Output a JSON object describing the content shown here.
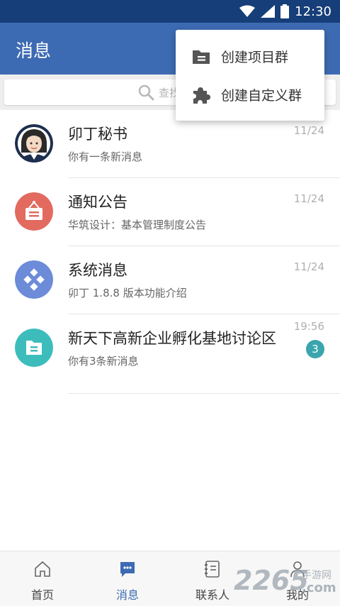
{
  "status_bar": {
    "time": "12:30"
  },
  "header": {
    "title": "消息"
  },
  "search": {
    "placeholder": "查找"
  },
  "popup_menu": {
    "items": [
      {
        "label": "创建项目群",
        "icon": "folder-icon"
      },
      {
        "label": "创建自定义群",
        "icon": "puzzle-icon"
      }
    ]
  },
  "messages": [
    {
      "title": "卯丁秘书",
      "subtitle": "你有一条新消息",
      "time": "11/24",
      "avatar": "secretary-avatar"
    },
    {
      "title": "通知公告",
      "subtitle": "华筑设计：基本管理制度公告",
      "time": "11/24",
      "avatar": "notice-icon",
      "avatar_color": "#e36a5f"
    },
    {
      "title": "系统消息",
      "subtitle": "卯丁 1.8.8 版本功能介绍",
      "time": "11/24",
      "avatar": "system-icon",
      "avatar_color": "#6c8bd8"
    },
    {
      "title": "新天下高新企业孵化基地讨论区",
      "subtitle": "你有3条新消息",
      "time": "19:56",
      "badge": "3",
      "avatar": "folder-icon",
      "avatar_color": "#3dbcbc"
    }
  ],
  "bottom_nav": {
    "items": [
      {
        "label": "首页",
        "icon": "home-icon"
      },
      {
        "label": "消息",
        "icon": "chat-icon",
        "active": true
      },
      {
        "label": "联系人",
        "icon": "contacts-icon"
      },
      {
        "label": "我的",
        "icon": "person-icon"
      }
    ]
  },
  "watermark": {
    "main": "2265",
    "sub": "手游网",
    "com": ".com"
  },
  "colors": {
    "status_bar": "#163e78",
    "app_bar": "#3d6bb3",
    "accent": "#3d6bb3",
    "badge": "#3aa5ad"
  }
}
